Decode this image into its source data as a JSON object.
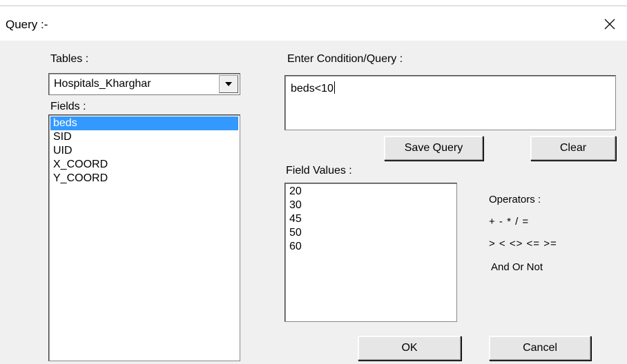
{
  "window": {
    "title": "Query :-"
  },
  "tables": {
    "label": "Tables :",
    "selected": "Hospitals_Kharghar"
  },
  "fields": {
    "label": "Fields :",
    "items": [
      "beds",
      "SID",
      "UID",
      "X_COORD",
      "Y_COORD"
    ],
    "selected_index": 0
  },
  "condition": {
    "label": "Enter Condition/Query :",
    "value": "beds<10"
  },
  "buttons": {
    "save_query": "Save Query",
    "clear": "Clear",
    "ok": "OK",
    "cancel": "Cancel"
  },
  "field_values": {
    "label": "Field Values :",
    "items": [
      "20",
      "30",
      "45",
      "50",
      "60"
    ]
  },
  "operators": {
    "label": "Operators :",
    "arithmetic": "+ - * / =",
    "comparison": "> < <> <= >=",
    "logical": "And Or Not"
  },
  "colors": {
    "selection": "#3399ff",
    "dialog_bg": "#f0f0f0"
  }
}
